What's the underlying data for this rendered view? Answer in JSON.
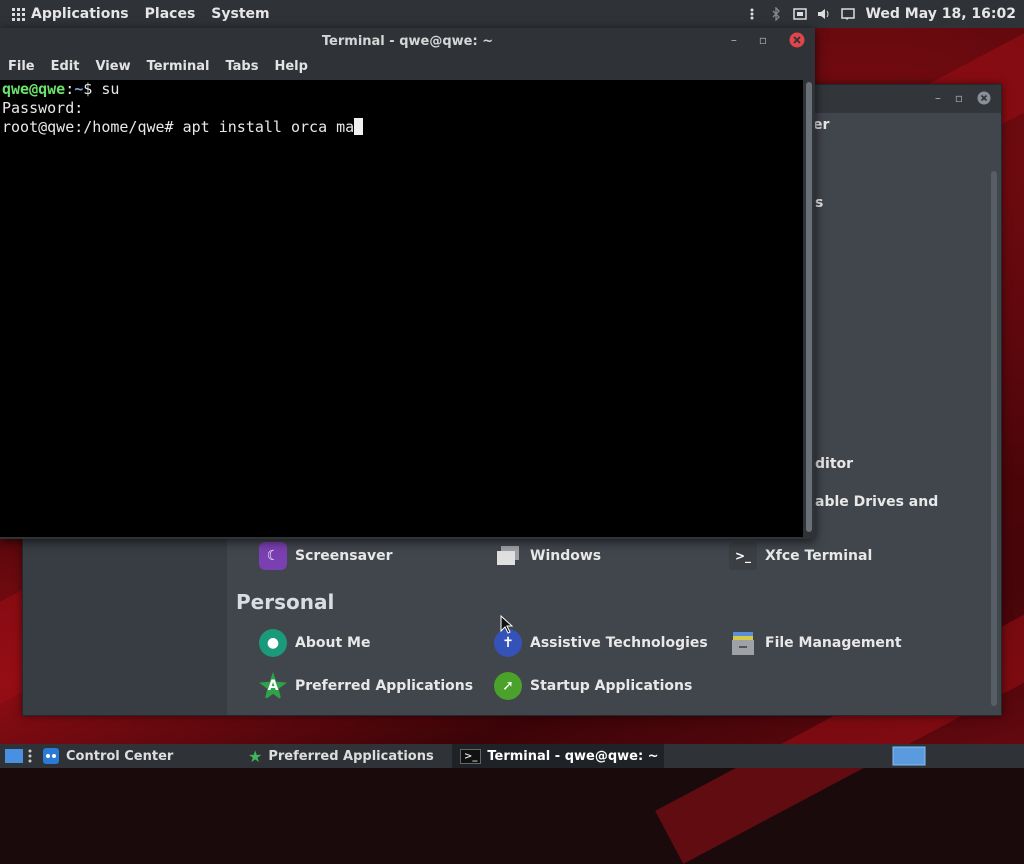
{
  "top_panel": {
    "menus": [
      "Applications",
      "Places",
      "System"
    ],
    "clock": "Wed May 18, 16:02"
  },
  "terminal": {
    "title": "Terminal - qwe@qwe: ~",
    "menu": [
      "File",
      "Edit",
      "View",
      "Terminal",
      "Tabs",
      "Help"
    ],
    "lines": {
      "l1_user": "qwe@qwe",
      "l1_sep": ":",
      "l1_path": "~",
      "l1_cmd": "$ su",
      "l2": "Password:",
      "l3": "root@qwe:/home/qwe# apt install orca ma"
    }
  },
  "control_center": {
    "partial_labels": [
      "er",
      "s",
      "ditor",
      "able Drives and"
    ],
    "hardware_row": [
      {
        "label": "Screensaver",
        "icon": "screensaver-icon",
        "color": "#7a3fb0"
      },
      {
        "label": "Windows",
        "icon": "windows-icon",
        "color": "#cfcfcf"
      },
      {
        "label": "Xfce Terminal",
        "icon": "terminal-icon",
        "color": "#333"
      }
    ],
    "section_personal": "Personal",
    "personal_items": [
      {
        "label": "About Me",
        "icon": "user-icon",
        "color": "#1a9a7a"
      },
      {
        "label": "Assistive Technologies",
        "icon": "accessibility-icon",
        "color": "#3552b8"
      },
      {
        "label": "File Management",
        "icon": "file-cabinet-icon",
        "color": "#8a8d90"
      },
      {
        "label": "Preferred Applications",
        "icon": "preferred-apps-icon",
        "color": "#2fa34a"
      },
      {
        "label": "Startup Applications",
        "icon": "rocket-icon",
        "color": "#4aa22a"
      }
    ]
  },
  "taskbar": {
    "tasks": [
      {
        "label": "Control Center",
        "active": false
      },
      {
        "label": "Preferred Applications",
        "active": false
      },
      {
        "label": "Terminal - qwe@qwe: ~",
        "active": true
      }
    ]
  }
}
